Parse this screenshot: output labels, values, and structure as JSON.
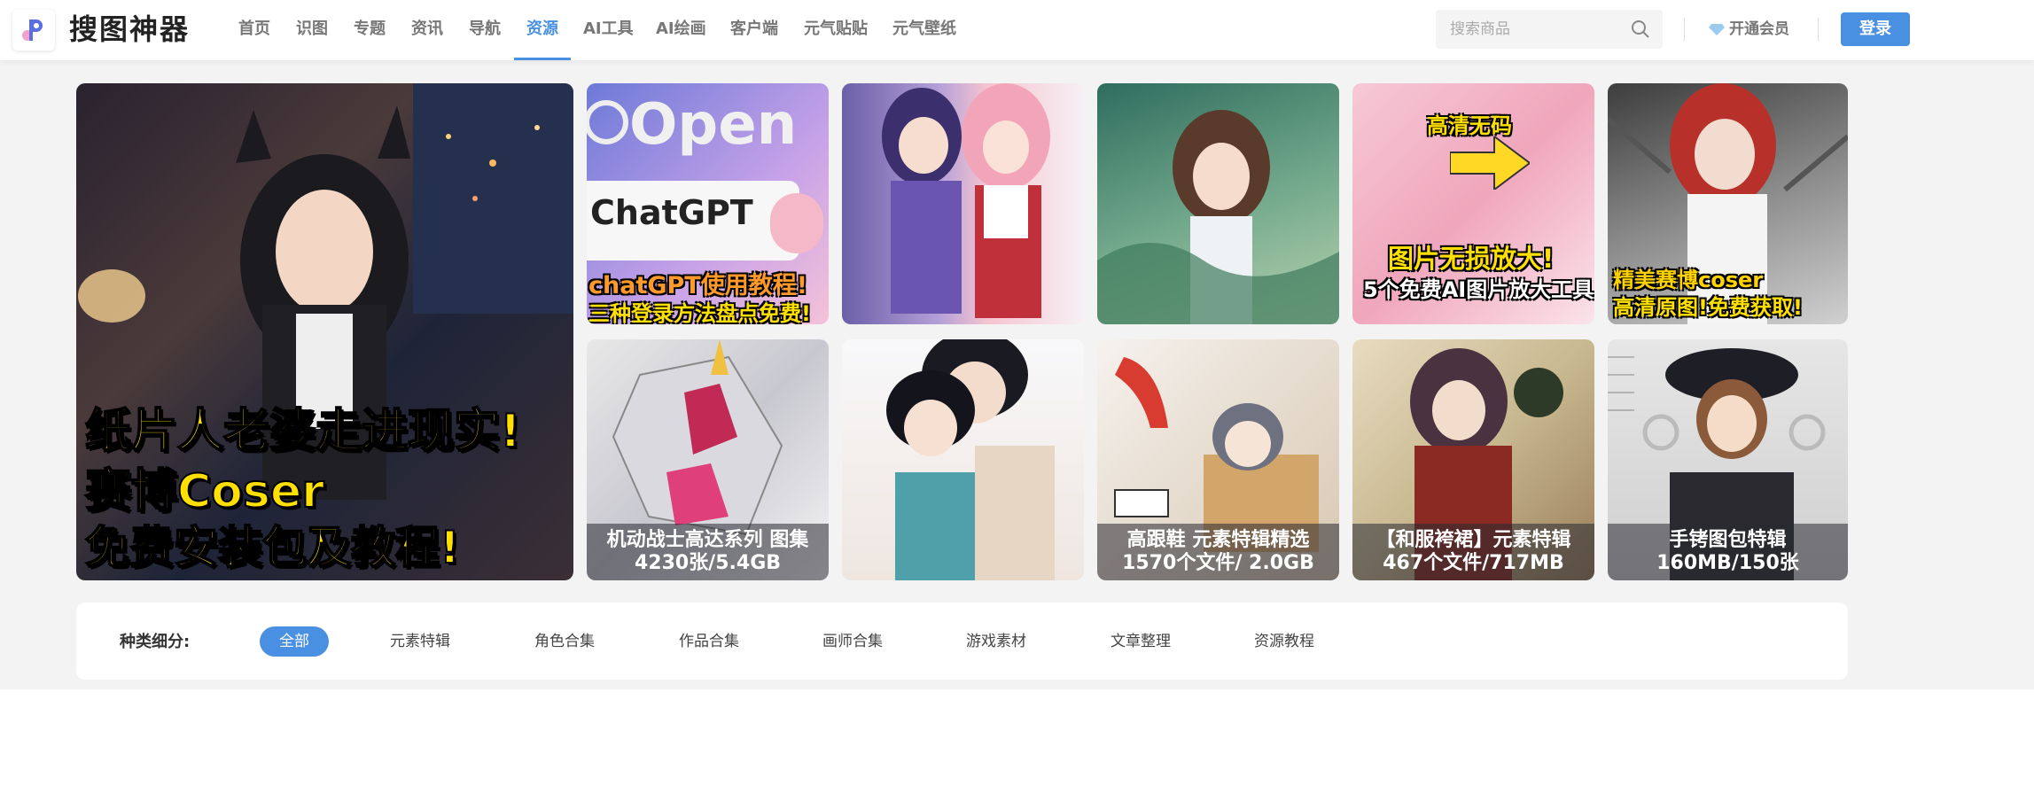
{
  "brand": {
    "name": "搜图神器"
  },
  "nav": {
    "items": [
      {
        "label": "首页"
      },
      {
        "label": "识图"
      },
      {
        "label": "专题"
      },
      {
        "label": "资讯"
      },
      {
        "label": "导航"
      },
      {
        "label": "资源"
      },
      {
        "label": "AI工具"
      },
      {
        "label": "AI绘画"
      },
      {
        "label": "客户端"
      },
      {
        "label": "元气贴贴"
      },
      {
        "label": "元气壁纸"
      }
    ],
    "active_index": 5
  },
  "search": {
    "placeholder": "搜索商品"
  },
  "account": {
    "vip_label": "开通会员",
    "login_label": "登录"
  },
  "banner": {
    "lines": [
      "纸片人老婆走进现实!",
      "赛博Coser",
      "免费安装包及教程!"
    ]
  },
  "tiles": [
    {
      "top_text": "chatGPT使用教程!",
      "bottom_text": "三种登录方法盘点免费!",
      "logo_text": "Open",
      "screen_text": "ChatGPT"
    },
    {},
    {},
    {
      "top_text": "高清无码",
      "mid_text": "图片无损放大!",
      "bottom_text": "5个免费AI图片放大工具"
    },
    {
      "top_text": "精美赛博coser",
      "bottom_text": "高清原图!免费获取!"
    },
    {
      "caption_1": "机动战士高达系列 图集",
      "caption_2": "4230张/5.4GB"
    },
    {},
    {
      "caption_1": "高跟鞋 元素特辑精选",
      "caption_2": "1570个文件/ 2.0GB"
    },
    {
      "caption_1": "【和服袴裙】元素特辑",
      "caption_2": "467个文件/717MB"
    },
    {
      "caption_1": "手铐图包特辑",
      "caption_2": "160MB/150张"
    }
  ],
  "carousel": {
    "slides": 5,
    "active": 0
  },
  "categories": {
    "label": "种类细分:",
    "items": [
      "全部",
      "元素特辑",
      "角色合集",
      "作品合集",
      "画师合集",
      "游戏素材",
      "文章整理",
      "资源教程"
    ],
    "active_index": 0
  },
  "colors": {
    "accent": "#4a90e2",
    "highlight_text": "#ffe000"
  }
}
